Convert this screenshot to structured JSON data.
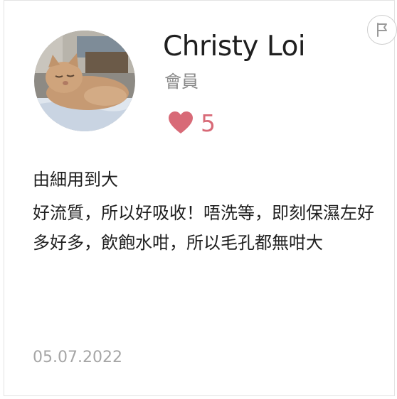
{
  "review": {
    "reviewer_name": "Christy Loi",
    "reviewer_role": "會員",
    "likes": "5",
    "title": "由細用到大",
    "body": "好流質，所以好吸收！唔洗等，即刻保濕左好多好多，飲飽水咁，所以毛孔都無咁大",
    "date": "05.07.2022"
  },
  "icons": {
    "like": "heart-icon",
    "report": "flag-icon"
  },
  "colors": {
    "heart": "#d86a77",
    "name": "#1f1f1f",
    "role": "#8a8a8a",
    "date": "#a6a6a6",
    "border": "#e3e3e3"
  }
}
